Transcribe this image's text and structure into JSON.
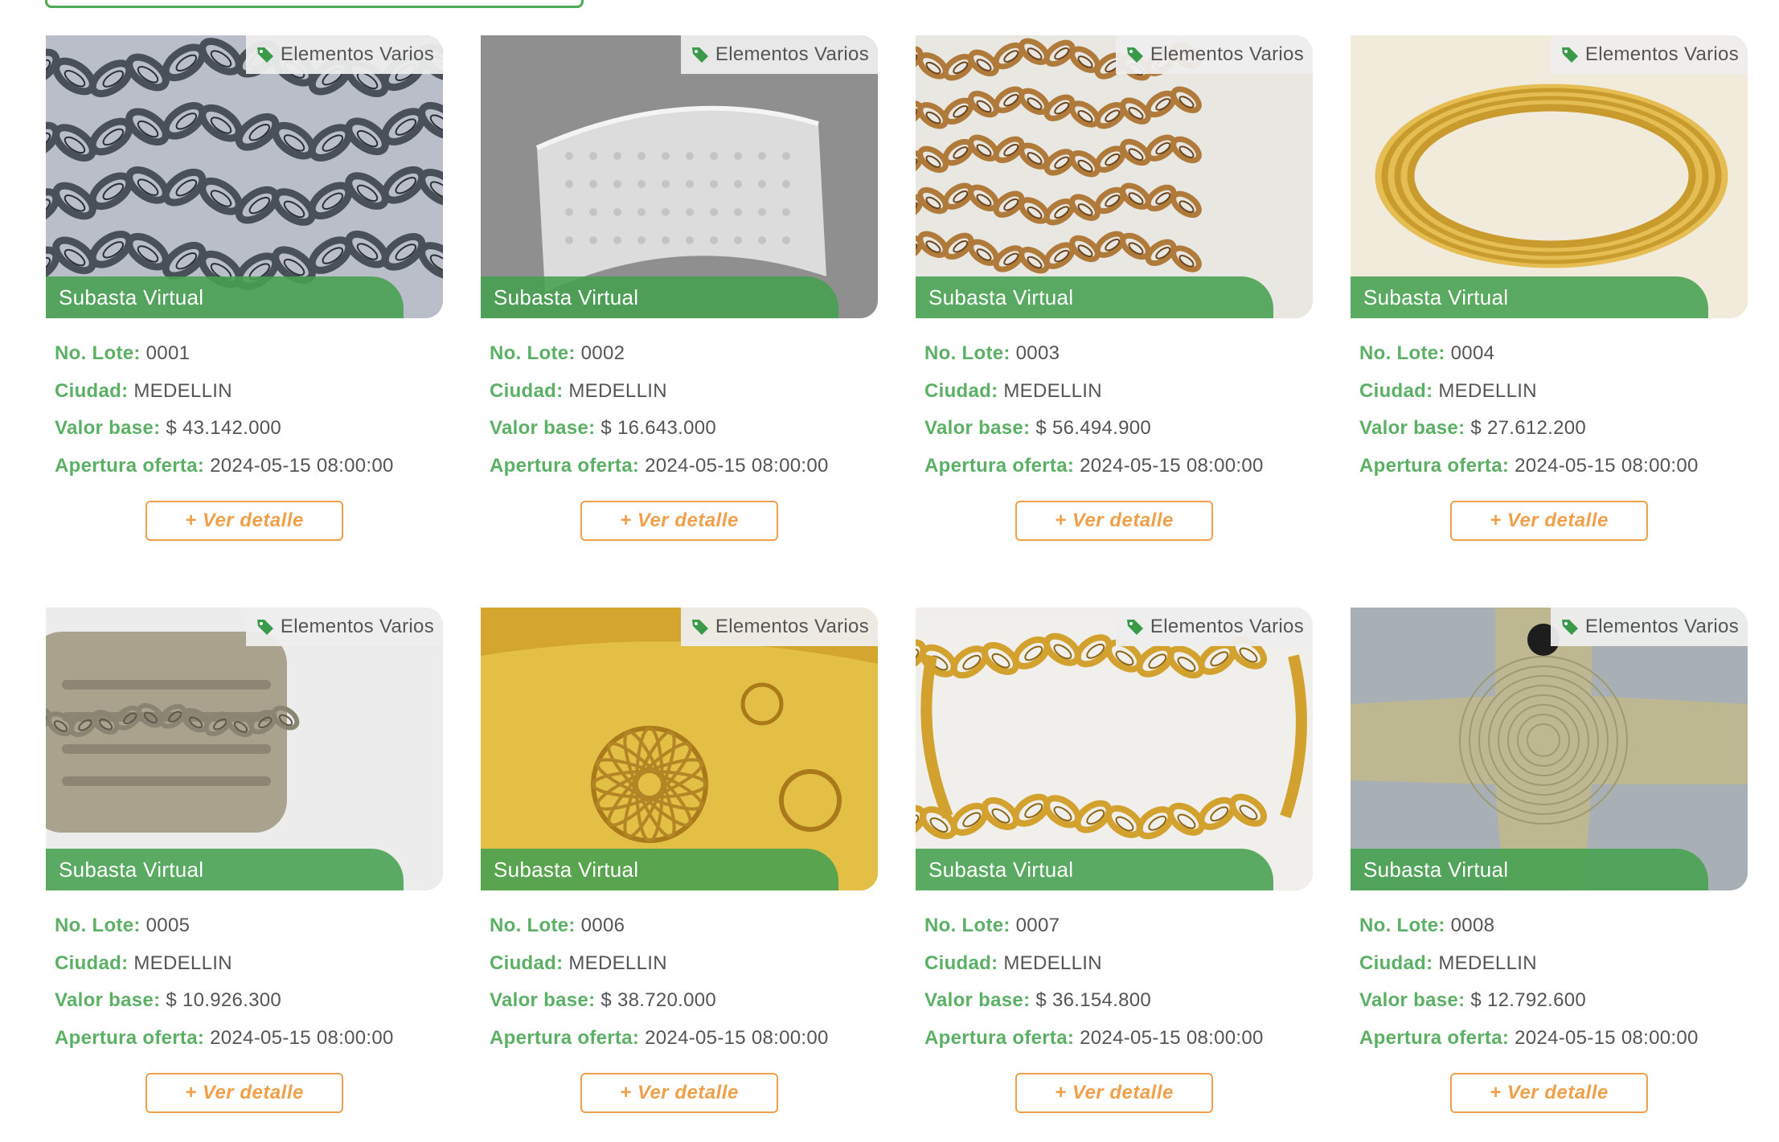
{
  "colors": {
    "accent": "#5cb066",
    "button": "#f0a04a",
    "ribbon": "#46a050"
  },
  "labels": {
    "lote": "No. Lote:",
    "ciudad": "Ciudad:",
    "valor": "Valor base:",
    "apertura": "Apertura oferta:",
    "button": "+ Ver detalle"
  },
  "lots": [
    {
      "category": "Elementos Varios",
      "category_icon": "tag-icon",
      "ribbon": "Subasta Virtual",
      "lote": "0001",
      "ciudad": "MEDELLIN",
      "valor": "$ 43.142.000",
      "apertura": "2024-05-15 08:00:00",
      "image": "silver-chain"
    },
    {
      "category": "Elementos Varios",
      "category_icon": "tag-icon",
      "ribbon": "Subasta Virtual",
      "lote": "0002",
      "ciudad": "MEDELLIN",
      "valor": "$ 16.643.000",
      "apertura": "2024-05-15 08:00:00",
      "image": "silver-cuff"
    },
    {
      "category": "Elementos Varios",
      "category_icon": "tag-icon",
      "ribbon": "Subasta Virtual",
      "lote": "0003",
      "ciudad": "MEDELLIN",
      "valor": "$ 56.494.900",
      "apertura": "2024-05-15 08:00:00",
      "image": "gold-chain"
    },
    {
      "category": "Elementos Varios",
      "category_icon": "tag-icon",
      "ribbon": "Subasta Virtual",
      "lote": "0004",
      "ciudad": "MEDELLIN",
      "valor": "$ 27.612.200",
      "apertura": "2024-05-15 08:00:00",
      "image": "gold-bangles"
    },
    {
      "category": "Elementos Varios",
      "category_icon": "tag-icon",
      "ribbon": "Subasta Virtual",
      "lote": "0005",
      "ciudad": "MEDELLIN",
      "valor": "$ 10.926.300",
      "apertura": "2024-05-15 08:00:00",
      "image": "silver-plate"
    },
    {
      "category": "Elementos Varios",
      "category_icon": "tag-icon",
      "ribbon": "Subasta Virtual",
      "lote": "0006",
      "ciudad": "MEDELLIN",
      "valor": "$ 38.720.000",
      "apertura": "2024-05-15 08:00:00",
      "image": "gold-engraved-cuff"
    },
    {
      "category": "Elementos Varios",
      "category_icon": "tag-icon",
      "ribbon": "Subasta Virtual",
      "lote": "0007",
      "ciudad": "MEDELLIN",
      "valor": "$ 36.154.800",
      "apertura": "2024-05-15 08:00:00",
      "image": "gold-chain-bracelet"
    },
    {
      "category": "Elementos Varios",
      "category_icon": "tag-icon",
      "ribbon": "Subasta Virtual",
      "lote": "0008",
      "ciudad": "MEDELLIN",
      "valor": "$ 12.792.600",
      "apertura": "2024-05-15 08:00:00",
      "image": "gold-cross"
    }
  ]
}
